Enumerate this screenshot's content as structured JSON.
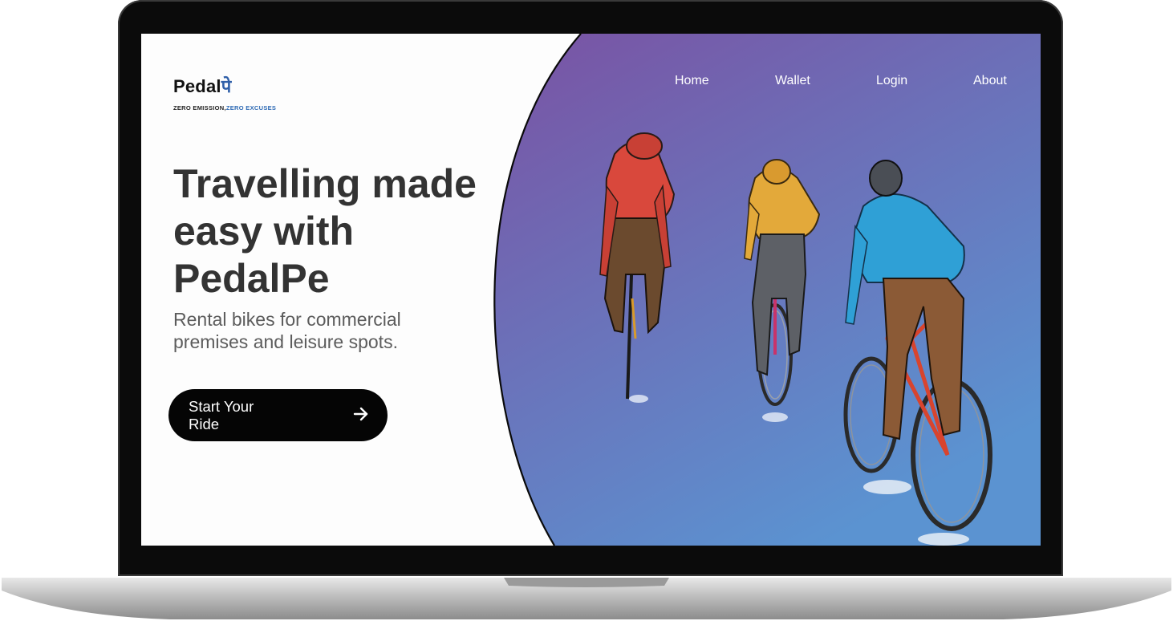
{
  "brand": {
    "name_latin": "Pedal",
    "name_script": "पे",
    "tagline_part1": "ZERO EMISSION,",
    "tagline_part2": "ZERO EXCUSES"
  },
  "nav": {
    "items": [
      {
        "label": "Home"
      },
      {
        "label": "Wallet"
      },
      {
        "label": "Login"
      },
      {
        "label": "About"
      }
    ]
  },
  "hero": {
    "headline": "Travelling made easy with PedalPe",
    "subtitle": "Rental bikes for commercial premises and leisure spots.",
    "cta_label": "Start Your Ride",
    "cta_icon": "arrow-right-icon"
  },
  "colors": {
    "gradient_top": "#7a52a3",
    "gradient_bottom": "#5b93d1",
    "brand_accent": "#2f5fa8",
    "cta_bg": "#050505",
    "headline": "#333333"
  },
  "illustration": {
    "subject": "three-cyclists",
    "jackets": [
      "#d9483c",
      "#e3a93a",
      "#2fa0d6"
    ]
  }
}
